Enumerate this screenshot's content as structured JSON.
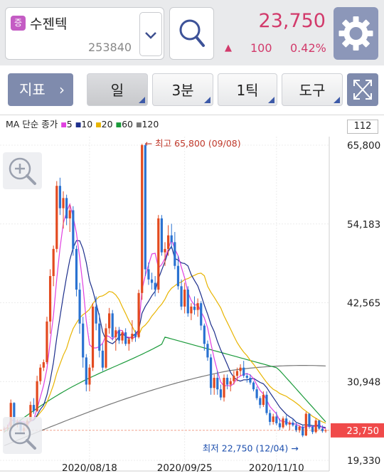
{
  "header": {
    "badge": "증",
    "stock_name": "수젠텍",
    "stock_code": "253840",
    "price": "23,750",
    "change_arrow": "▲",
    "change_value": "100",
    "change_pct": "0.42%"
  },
  "toolbar": {
    "indicator_label": "지표",
    "indicator_chevron": "›",
    "day_label": "일",
    "min3_label": "3분",
    "tick1_label": "1틱",
    "tools_label": "도구"
  },
  "legend": {
    "title": "MA 단순 종가",
    "items": [
      {
        "label": "5",
        "color": "#e040e0"
      },
      {
        "label": "10",
        "color": "#1d2f8c"
      },
      {
        "label": "20",
        "color": "#e8b400"
      },
      {
        "label": "60",
        "color": "#1a9a3a"
      },
      {
        "label": "120",
        "color": "#777777"
      }
    ]
  },
  "scale_value": "112",
  "colors": {
    "up": "#e34a1f",
    "down": "#2a72d1",
    "accent": "#d23a6b",
    "button": "#7f8bad"
  },
  "chart_data": {
    "type": "candlestick",
    "y_ticks": [
      "65,800",
      "54,183",
      "42,565",
      "30,948",
      "19,330"
    ],
    "ylim": [
      19330,
      65800
    ],
    "x_ticks": [
      "2020/08/18",
      "2020/09/25",
      "2020/11/10"
    ],
    "current_price": "23,750",
    "max_label": "최고 65,800 (09/08)",
    "min_label": "최저 22,750 (12/04)",
    "candles": [
      [
        23800,
        24300,
        23400,
        24000
      ],
      [
        24000,
        24600,
        23600,
        24200
      ],
      [
        24200,
        28300,
        24000,
        27800
      ],
      [
        27800,
        27900,
        24300,
        24600
      ],
      [
        24600,
        25400,
        24200,
        25000
      ],
      [
        25000,
        25200,
        23300,
        23700
      ],
      [
        23700,
        24500,
        23200,
        24100
      ],
      [
        24100,
        25500,
        23900,
        25200
      ],
      [
        25200,
        28000,
        25000,
        27500
      ],
      [
        27500,
        28500,
        26200,
        26600
      ],
      [
        26600,
        31800,
        26500,
        31000
      ],
      [
        31000,
        33500,
        30500,
        33000
      ],
      [
        33000,
        34200,
        32500,
        33800
      ],
      [
        33800,
        40500,
        33500,
        39800
      ],
      [
        39800,
        47500,
        38000,
        46500
      ],
      [
        46500,
        51000,
        45000,
        50500
      ],
      [
        50500,
        60500,
        50000,
        59800
      ],
      [
        59800,
        61000,
        55500,
        56500
      ],
      [
        56500,
        59000,
        53500,
        58000
      ],
      [
        58000,
        58500,
        54000,
        55000
      ],
      [
        55000,
        57000,
        53000,
        56200
      ],
      [
        56200,
        56800,
        49500,
        50500
      ],
      [
        50500,
        51000,
        43500,
        44500
      ],
      [
        44500,
        45500,
        38000,
        39500
      ],
      [
        39500,
        40500,
        33000,
        34500
      ],
      [
        34500,
        35000,
        29500,
        30500
      ],
      [
        30500,
        33500,
        29500,
        33000
      ],
      [
        33000,
        42500,
        32500,
        42000
      ],
      [
        42000,
        43500,
        38500,
        39500
      ],
      [
        39500,
        41000,
        34500,
        35500
      ],
      [
        35500,
        36500,
        32500,
        33000
      ],
      [
        33000,
        39500,
        32800,
        38800
      ],
      [
        38800,
        41800,
        38000,
        41000
      ],
      [
        41000,
        41500,
        37000,
        37500
      ],
      [
        37500,
        39000,
        35500,
        38500
      ],
      [
        38500,
        39000,
        36500,
        37000
      ],
      [
        37000,
        38500,
        36500,
        38200
      ],
      [
        38200,
        38800,
        36200,
        36500
      ],
      [
        36500,
        37500,
        35500,
        37200
      ],
      [
        37200,
        40000,
        36800,
        38000
      ],
      [
        38000,
        38500,
        36800,
        37500
      ],
      [
        37500,
        44500,
        37300,
        44000
      ],
      [
        44000,
        66000,
        43000,
        65800
      ],
      [
        65800,
        66000,
        46500,
        47500
      ],
      [
        47500,
        48500,
        45200,
        46000
      ],
      [
        46000,
        47000,
        44500,
        45500
      ],
      [
        45500,
        46500,
        43500,
        44500
      ],
      [
        44500,
        55500,
        44000,
        55000
      ],
      [
        55000,
        55500,
        49500,
        50000
      ],
      [
        50000,
        51500,
        48000,
        50500
      ],
      [
        50500,
        54000,
        49500,
        52500
      ],
      [
        52500,
        54200,
        50500,
        51500
      ],
      [
        51500,
        53000,
        47500,
        48000
      ],
      [
        48000,
        49500,
        44500,
        45000
      ],
      [
        45000,
        46000,
        41500,
        42000
      ],
      [
        42000,
        45500,
        41000,
        44500
      ],
      [
        44500,
        45000,
        40500,
        41000
      ],
      [
        41000,
        42500,
        40000,
        42000
      ],
      [
        42000,
        43500,
        40800,
        41500
      ],
      [
        41500,
        43200,
        40500,
        42500
      ],
      [
        42500,
        42800,
        38500,
        39200
      ],
      [
        39200,
        39500,
        35500,
        36500
      ],
      [
        36500,
        37000,
        34000,
        34500
      ],
      [
        34500,
        35000,
        29000,
        30000
      ],
      [
        30000,
        32000,
        29000,
        31500
      ],
      [
        31500,
        32500,
        29000,
        29800
      ],
      [
        29800,
        30500,
        28200,
        28600
      ],
      [
        28600,
        32000,
        28000,
        31500
      ],
      [
        31500,
        32000,
        29800,
        30500
      ],
      [
        30500,
        31500,
        29500,
        31000
      ],
      [
        31000,
        32500,
        30500,
        31800
      ],
      [
        31800,
        33000,
        31000,
        32500
      ],
      [
        32500,
        33500,
        31800,
        33000
      ],
      [
        33000,
        34000,
        31500,
        31800
      ],
      [
        31800,
        32200,
        30800,
        31500
      ],
      [
        31500,
        32000,
        30500,
        30800
      ],
      [
        30800,
        31000,
        29500,
        29800
      ],
      [
        29800,
        30200,
        28200,
        28500
      ],
      [
        28500,
        28800,
        27000,
        27500
      ],
      [
        27500,
        29500,
        27200,
        29000
      ],
      [
        29000,
        29500,
        26000,
        26300
      ],
      [
        26300,
        26800,
        24500,
        25000
      ],
      [
        25000,
        26200,
        24600,
        25800
      ],
      [
        25800,
        26500,
        24500,
        24800
      ],
      [
        24800,
        25500,
        23800,
        24200
      ],
      [
        24200,
        25800,
        24000,
        25500
      ],
      [
        25500,
        26000,
        24400,
        24600
      ],
      [
        24600,
        25200,
        23800,
        24900
      ],
      [
        24900,
        25500,
        24300,
        24500
      ],
      [
        24500,
        25000,
        23500,
        23800
      ],
      [
        23800,
        24500,
        23400,
        24300
      ],
      [
        24300,
        24600,
        22750,
        23000
      ],
      [
        23000,
        26500,
        22900,
        26200
      ],
      [
        26200,
        26300,
        24000,
        24300
      ],
      [
        24300,
        24500,
        23200,
        23500
      ],
      [
        23500,
        25500,
        23300,
        25200
      ],
      [
        25200,
        25300,
        23800,
        24000
      ],
      [
        24000,
        24500,
        23400,
        23650
      ],
      [
        23650,
        24000,
        23400,
        23750
      ]
    ]
  }
}
